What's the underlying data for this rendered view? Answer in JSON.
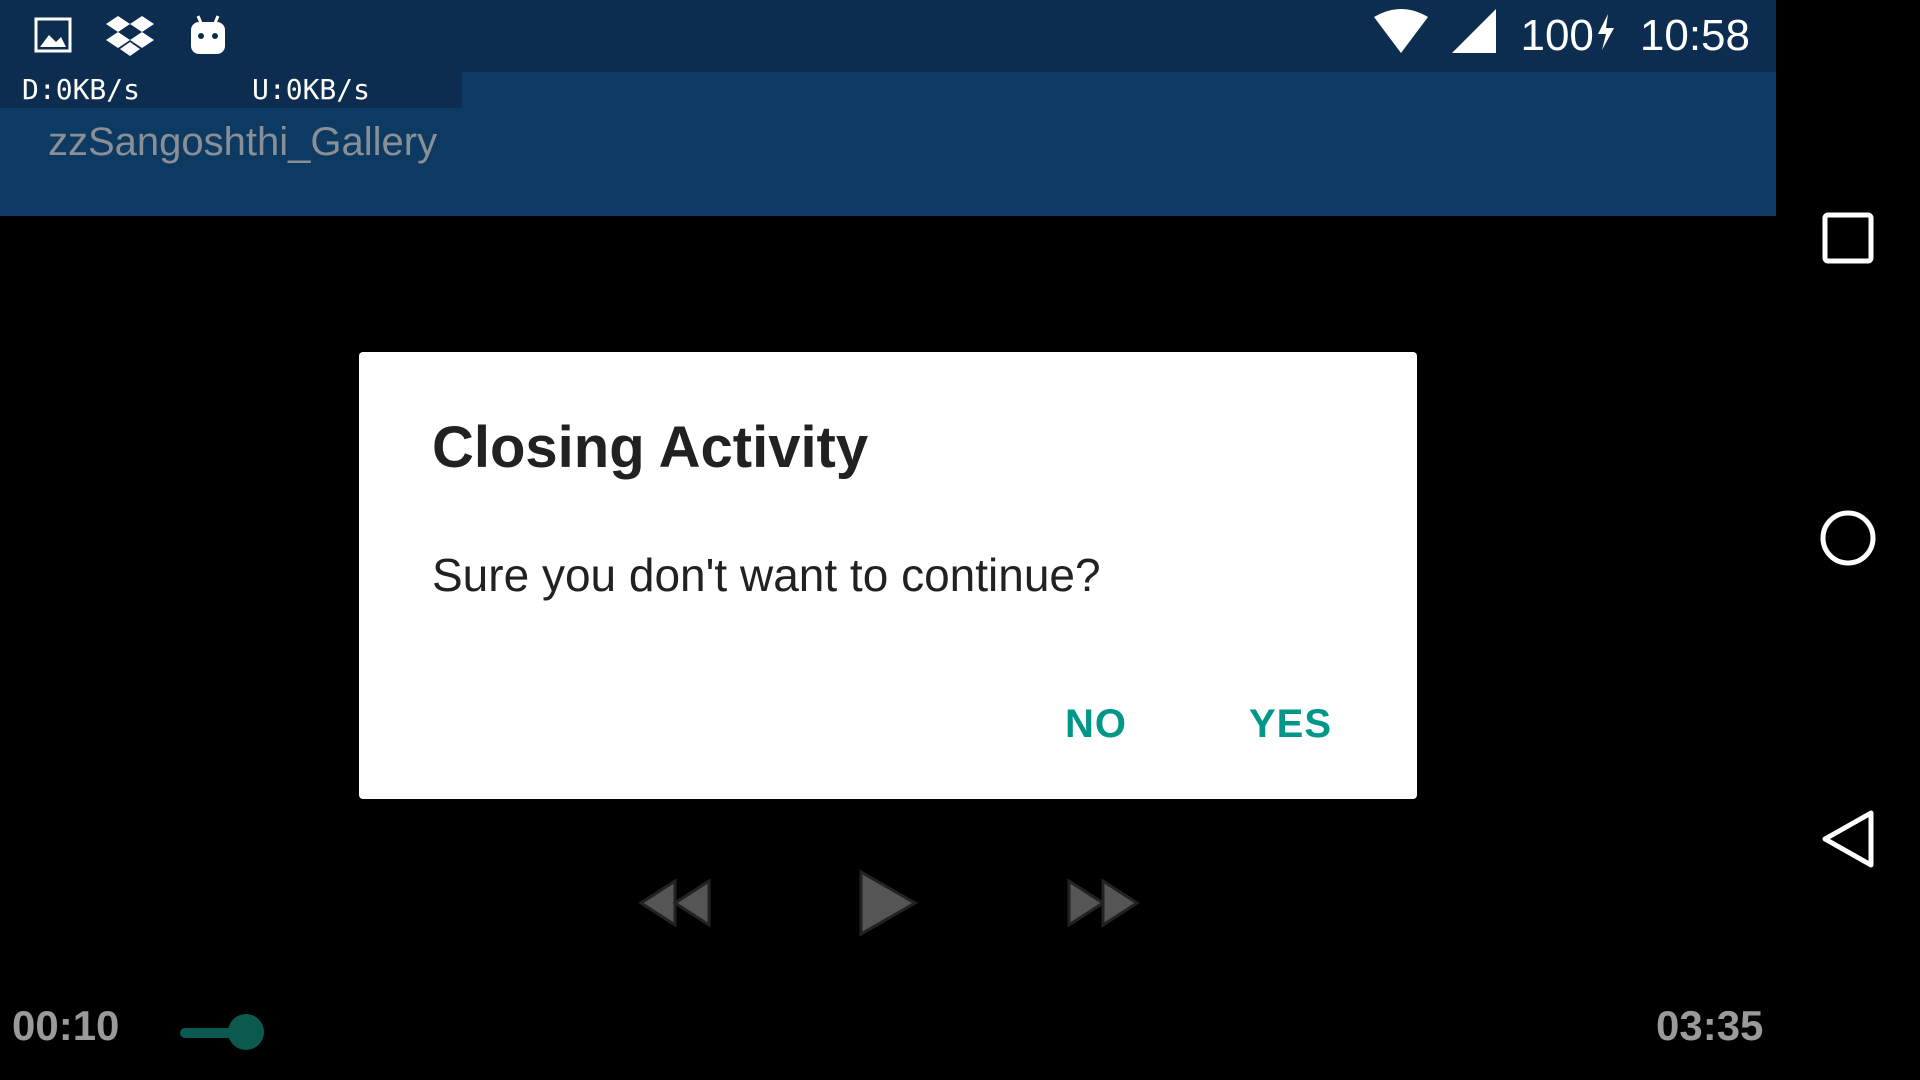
{
  "status_bar": {
    "icons_left": [
      "gallery-icon",
      "dropbox-icon",
      "android-icon"
    ],
    "battery": "100",
    "time": "10:58"
  },
  "app_bar": {
    "download_speed": "D:0KB/s",
    "upload_speed": "U:0KB/s",
    "title": "zzSangoshthi_Gallery"
  },
  "dialog": {
    "title": "Closing Activity",
    "message": "Sure you don't want to continue?",
    "negative_label": "NO",
    "positive_label": "YES",
    "accent_color": "#009688"
  },
  "player": {
    "current_time": "00:10",
    "total_time": "03:35",
    "progress_fraction": 0.047
  },
  "nav_bar": {
    "buttons": [
      "recents-icon",
      "home-icon",
      "back-icon"
    ]
  },
  "colors": {
    "status_bar": "#0c2d4f",
    "app_bar": "#0d3a62",
    "seek": "#0b5a4f"
  }
}
